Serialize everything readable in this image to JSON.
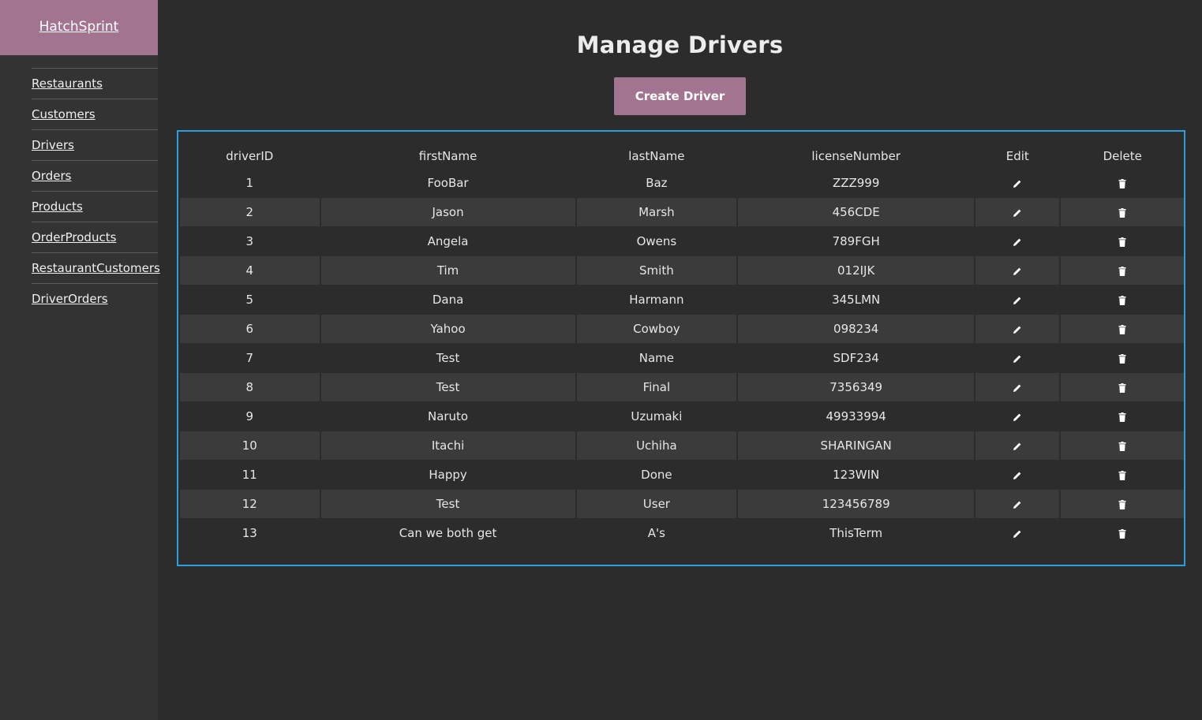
{
  "brand": {
    "name": "HatchSprint"
  },
  "sidebar": {
    "items": [
      {
        "label": "Restaurants",
        "name": "restaurants"
      },
      {
        "label": "Customers",
        "name": "customers"
      },
      {
        "label": "Drivers",
        "name": "drivers"
      },
      {
        "label": "Orders",
        "name": "orders"
      },
      {
        "label": "Products",
        "name": "products"
      },
      {
        "label": "OrderProducts",
        "name": "orderproducts"
      },
      {
        "label": "RestaurantCustomers",
        "name": "restaurantcustomers"
      },
      {
        "label": "DriverOrders",
        "name": "driverorders"
      }
    ]
  },
  "main": {
    "title": "Manage Drivers",
    "create_label": "Create Driver"
  },
  "table": {
    "headers": [
      "driverID",
      "firstName",
      "lastName",
      "licenseNumber",
      "Edit",
      "Delete"
    ],
    "rows": [
      {
        "driverID": "1",
        "firstName": "FooBar",
        "lastName": "Baz",
        "licenseNumber": "ZZZ999"
      },
      {
        "driverID": "2",
        "firstName": "Jason",
        "lastName": "Marsh",
        "licenseNumber": "456CDE"
      },
      {
        "driverID": "3",
        "firstName": "Angela",
        "lastName": "Owens",
        "licenseNumber": "789FGH"
      },
      {
        "driverID": "4",
        "firstName": "Tim",
        "lastName": "Smith",
        "licenseNumber": "012IJK"
      },
      {
        "driverID": "5",
        "firstName": "Dana",
        "lastName": "Harmann",
        "licenseNumber": "345LMN"
      },
      {
        "driverID": "6",
        "firstName": "Yahoo",
        "lastName": "Cowboy",
        "licenseNumber": "098234"
      },
      {
        "driverID": "7",
        "firstName": "Test",
        "lastName": "Name",
        "licenseNumber": "SDF234"
      },
      {
        "driverID": "8",
        "firstName": "Test",
        "lastName": "Final",
        "licenseNumber": "7356349"
      },
      {
        "driverID": "9",
        "firstName": "Naruto",
        "lastName": "Uzumaki",
        "licenseNumber": "49933994"
      },
      {
        "driverID": "10",
        "firstName": "Itachi",
        "lastName": "Uchiha",
        "licenseNumber": "SHARINGAN"
      },
      {
        "driverID": "11",
        "firstName": "Happy",
        "lastName": "Done",
        "licenseNumber": "123WIN"
      },
      {
        "driverID": "12",
        "firstName": "Test",
        "lastName": "User",
        "licenseNumber": "123456789"
      },
      {
        "driverID": "13",
        "firstName": "Can we both get",
        "lastName": "A's",
        "licenseNumber": "ThisTerm"
      }
    ],
    "edit_icon": "pencil-icon",
    "delete_icon": "trash-icon"
  },
  "colors": {
    "accent": "#a27490",
    "background": "#2c2c2c",
    "sidebar": "#333333",
    "table_border": "#2a9fd8",
    "row_alt": "#3b3b3b"
  }
}
